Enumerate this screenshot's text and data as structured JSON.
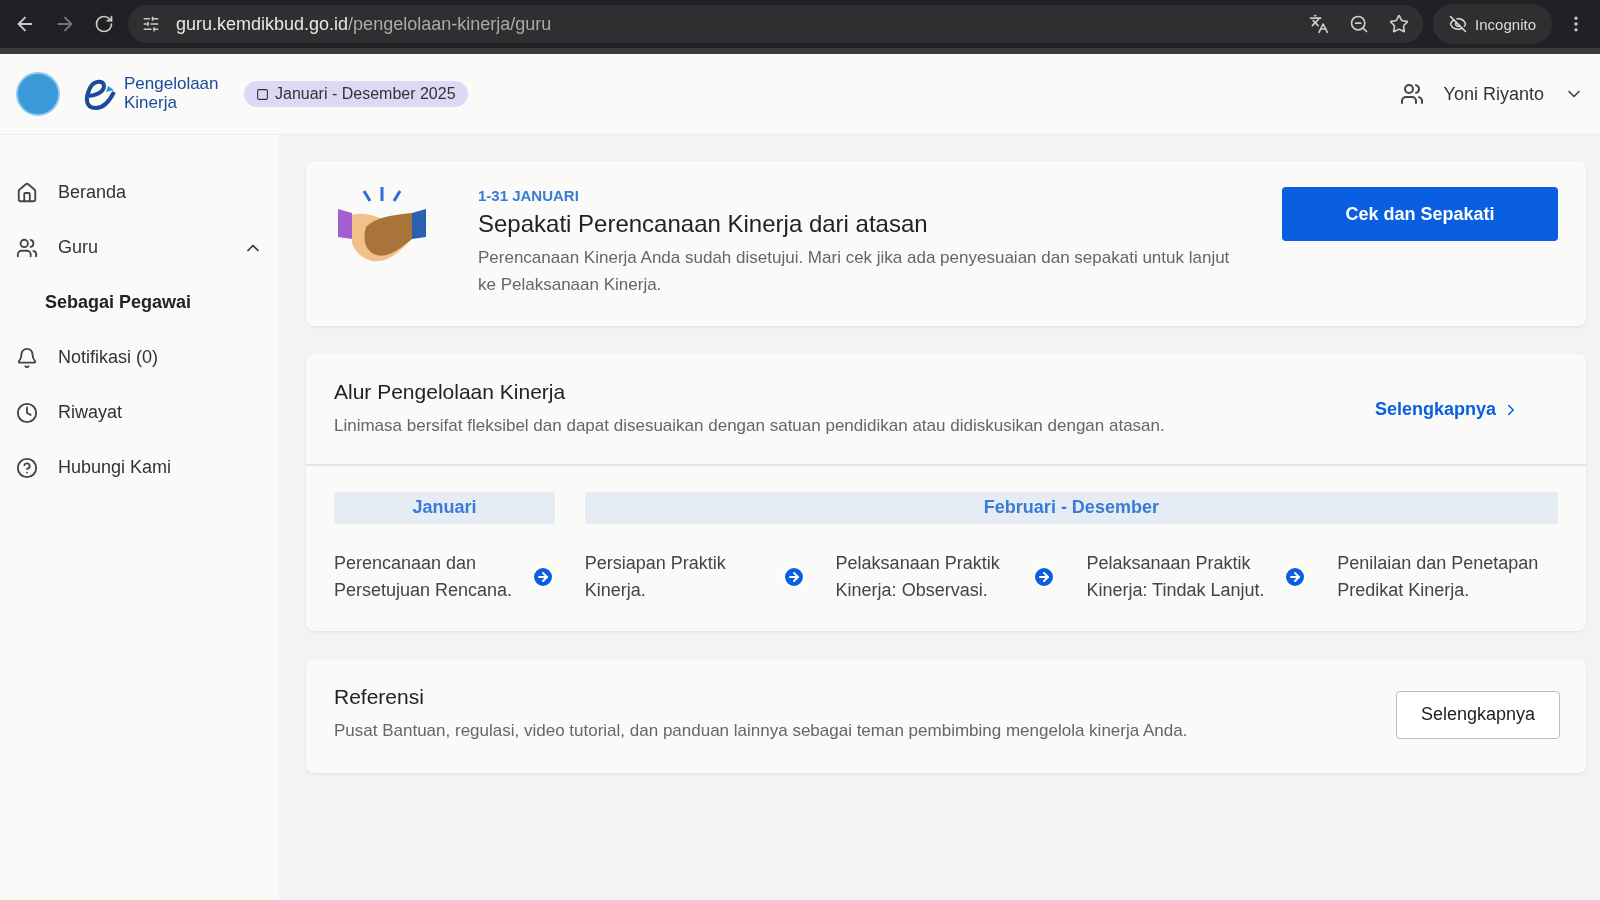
{
  "browser": {
    "url_host": "guru.kemdikbud.go.id",
    "url_path": "/pengelolaan-kinerja/guru",
    "profile": "Incognito"
  },
  "header": {
    "logo_text": "Pengelolaan Kinerja",
    "period": "Januari - Desember 2025",
    "user": "Yoni Riyanto"
  },
  "sidebar": {
    "items": [
      {
        "label": "Beranda",
        "selected": false
      },
      {
        "label": "Guru",
        "selected": false,
        "expanded": true,
        "children": [
          {
            "label": "Sebagai Pegawai",
            "selected": true
          }
        ]
      },
      {
        "label": "Notifikasi (0)",
        "selected": false
      },
      {
        "label": "Riwayat",
        "selected": false
      },
      {
        "label": "Hubungi Kami",
        "selected": false
      }
    ]
  },
  "task_card": {
    "date": "1-31 JANUARI",
    "title": "Sepakati Perencanaan Kinerja dari atasan",
    "description": "Perencanaan Kinerja Anda sudah disetujui. Mari cek jika ada penyesuaian dan sepakati untuk lanjut ke Pelaksanaan Kinerja.",
    "button": "Cek dan Sepakati"
  },
  "flow_card": {
    "title": "Alur Pengelolaan Kinerja",
    "description": "Linimasa bersifat fleksibel dan dapat disesuaikan dengan satuan pendidikan atau didiskusikan dengan atasan.",
    "link": "Selengkapnya",
    "phases": [
      {
        "label": "Januari",
        "steps": [
          "Perencanaan dan Persetujuan Rencana."
        ]
      },
      {
        "label": "Februari - Desember",
        "steps": [
          "Persiapan Praktik Kinerja.",
          "Pelaksanaan Praktik Kinerja: Observasi.",
          "Pelaksanaan Praktik Kinerja: Tindak Lanjut.",
          "Penilaian dan Penetapan Predikat Kinerja."
        ]
      }
    ]
  },
  "reference_card": {
    "title": "Referensi",
    "description": "Pusat Bantuan, regulasi, video tutorial, dan panduan lainnya sebagai teman pembimbing mengelola kinerja Anda.",
    "button": "Selengkapnya"
  }
}
